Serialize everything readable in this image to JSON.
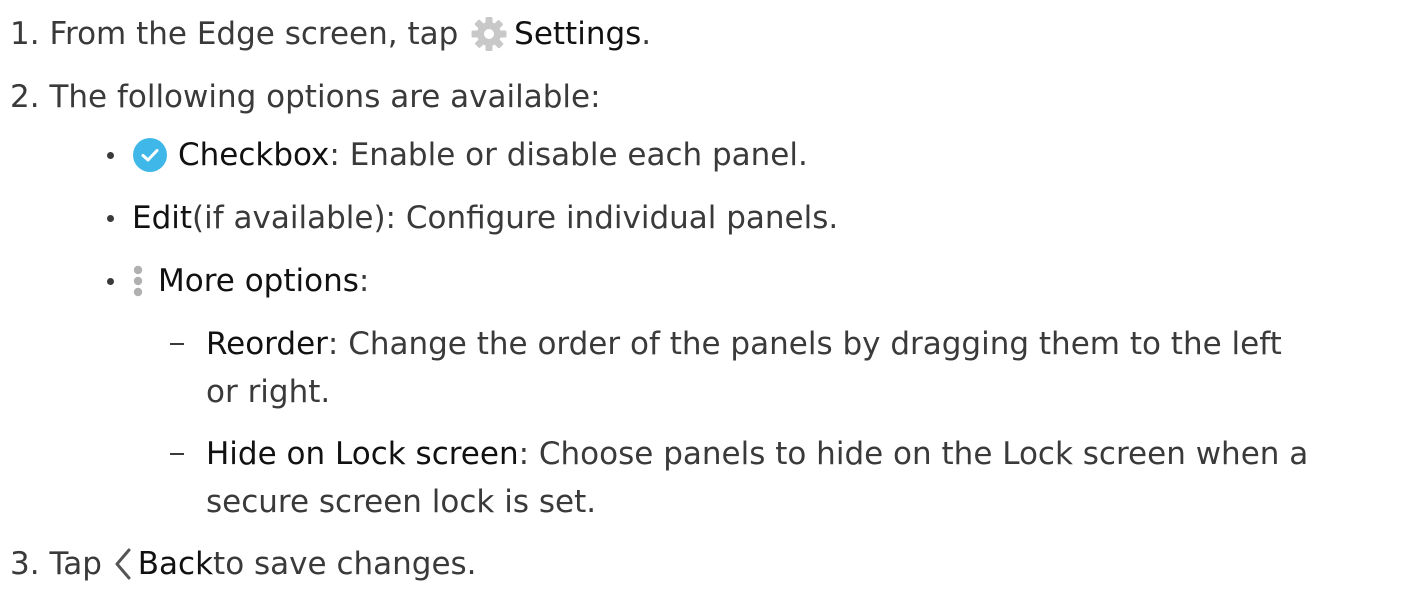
{
  "steps": [
    {
      "number": "1.",
      "pre": "From the Edge screen, tap",
      "icon": "gear-icon",
      "term": "Settings",
      "post": "."
    },
    {
      "number": "2.",
      "text": "The following options are available:",
      "options": [
        {
          "icon": "check-circle-icon",
          "term": "Checkbox",
          "desc": ": Enable or disable each panel."
        },
        {
          "term": "Edit",
          "desc": " (if available): Configure individual panels."
        },
        {
          "icon": "more-options-icon",
          "term": "More options",
          "desc": ":",
          "sub": [
            {
              "term": "Reorder",
              "desc_line1": ": Change the order of the panels by dragging them to the left",
              "desc_line2": "or right."
            },
            {
              "term": "Hide on Lock screen",
              "desc_line1": ": Choose panels to hide on the Lock screen when a",
              "desc_line2": "secure screen lock is set."
            }
          ]
        }
      ]
    },
    {
      "number": "3.",
      "pre": "Tap",
      "icon": "back-chevron-icon",
      "term": "Back",
      "post": " to save changes."
    }
  ],
  "colors": {
    "text": "#3a3a3a",
    "term": "#111111",
    "gear": "#c8c8c8",
    "check": "#3fb8e9"
  }
}
